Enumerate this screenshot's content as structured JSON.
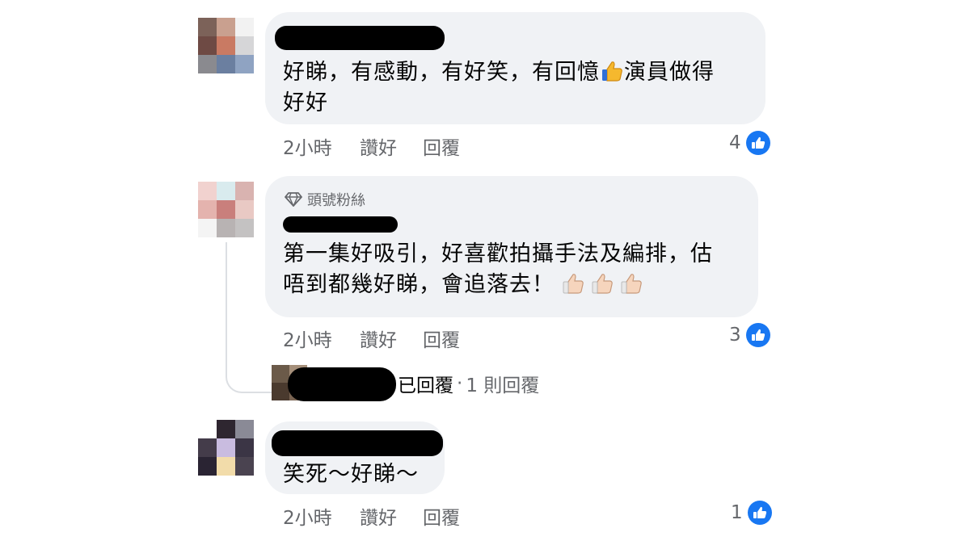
{
  "comments": [
    {
      "text_lines": [
        "好睇，有感動，有好笑，有回憶",
        "演員做得",
        "好好"
      ],
      "time": "2小時",
      "like_label": "讚好",
      "reply_label": "回覆",
      "reaction_count": "4"
    },
    {
      "badge": "頭號粉絲",
      "text_lines": [
        "第一集好吸引，好喜歡拍攝手法及編排，估",
        "唔到都幾好睇，會追落去！"
      ],
      "time": "2小時",
      "like_label": "讚好",
      "reply_label": "回覆",
      "reaction_count": "3",
      "replies_summary": {
        "action": "已回覆",
        "separator": "·",
        "count_label": "1 則回覆"
      }
    },
    {
      "text_lines": [
        "笑死～好睇～"
      ],
      "time": "2小時",
      "like_label": "讚好",
      "reply_label": "回覆",
      "reaction_count": "1"
    }
  ],
  "icons": {
    "like_reaction": "thumbs-up-icon",
    "badge": "diamond-icon",
    "emoji": "thumbs-up-emoji"
  },
  "colors": {
    "bubble": "#f0f2f5",
    "like_blue": "#1877f2",
    "meta_gray": "#65676b"
  }
}
